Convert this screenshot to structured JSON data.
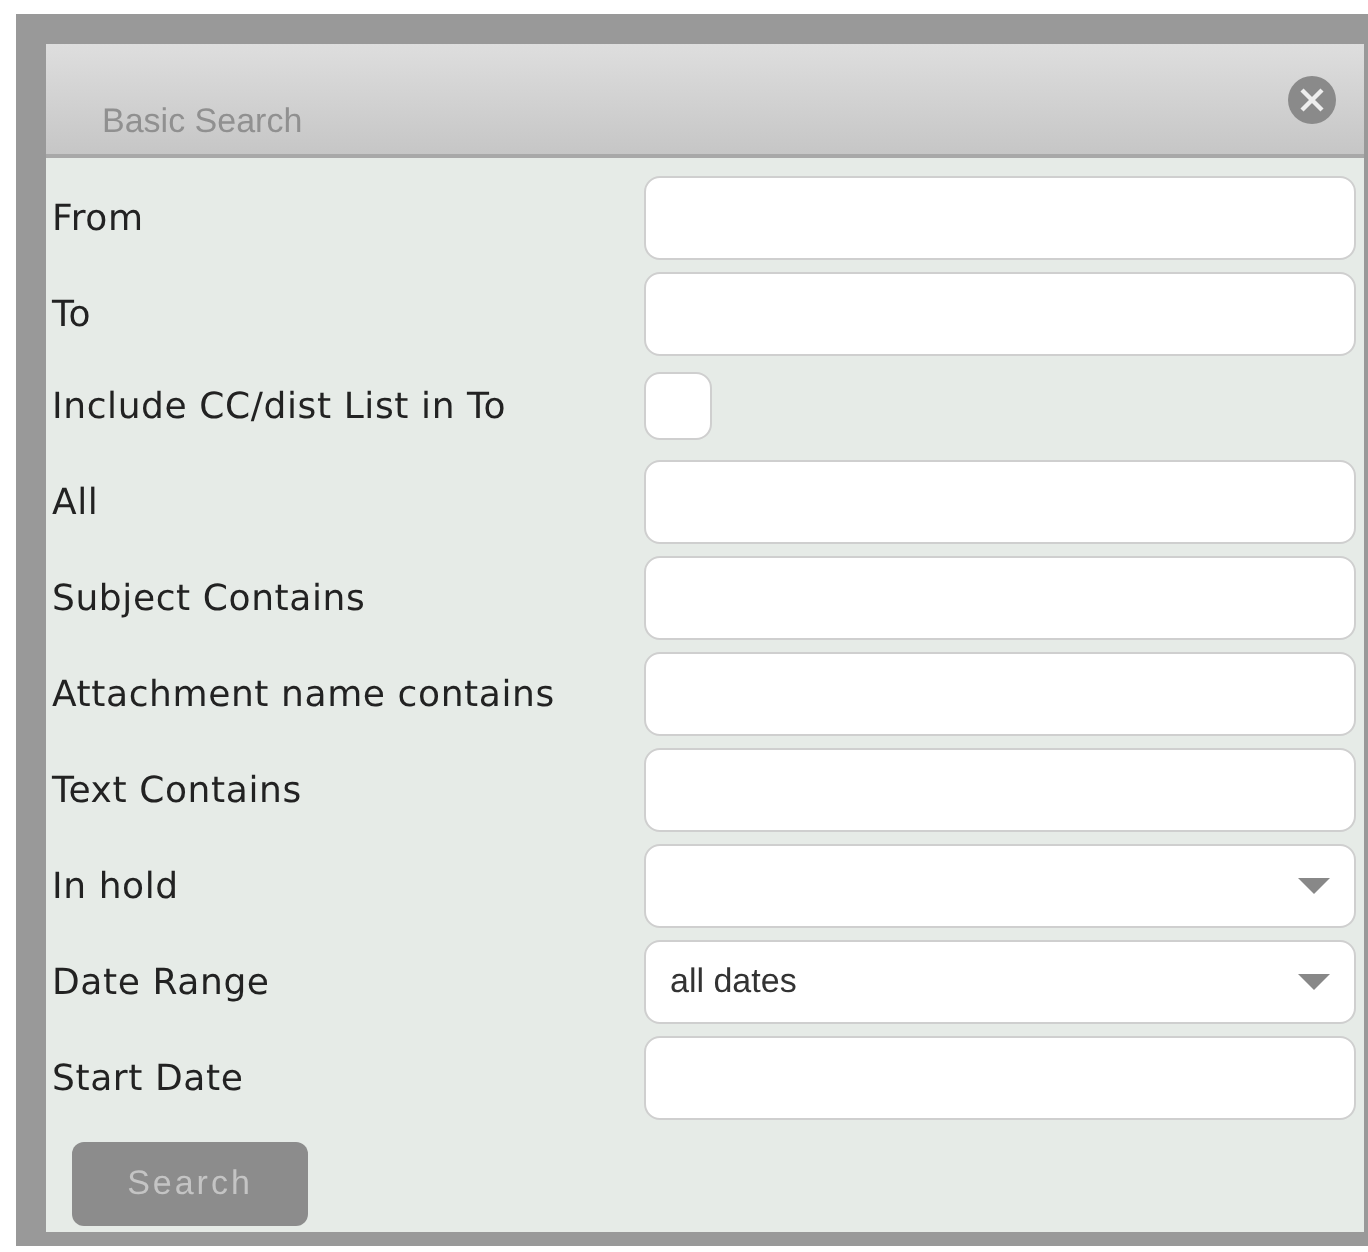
{
  "dialog": {
    "title": "Basic Search"
  },
  "fields": [
    {
      "label": "From",
      "kind": "text"
    },
    {
      "label": "To",
      "kind": "text"
    },
    {
      "label": "Include CC/dist List in To",
      "kind": "checkbox",
      "checked": false
    },
    {
      "label": "All",
      "kind": "text"
    },
    {
      "label": "Subject Contains",
      "kind": "text"
    },
    {
      "label": "Attachment name contains",
      "kind": "text"
    },
    {
      "label": "Text Contains",
      "kind": "text"
    },
    {
      "label": "In hold",
      "kind": "select"
    },
    {
      "label": "Date Range",
      "kind": "select",
      "value": "all dates"
    },
    {
      "label": "Start Date",
      "kind": "text"
    }
  ],
  "search_button": {
    "label": "Search",
    "disabled": true
  }
}
